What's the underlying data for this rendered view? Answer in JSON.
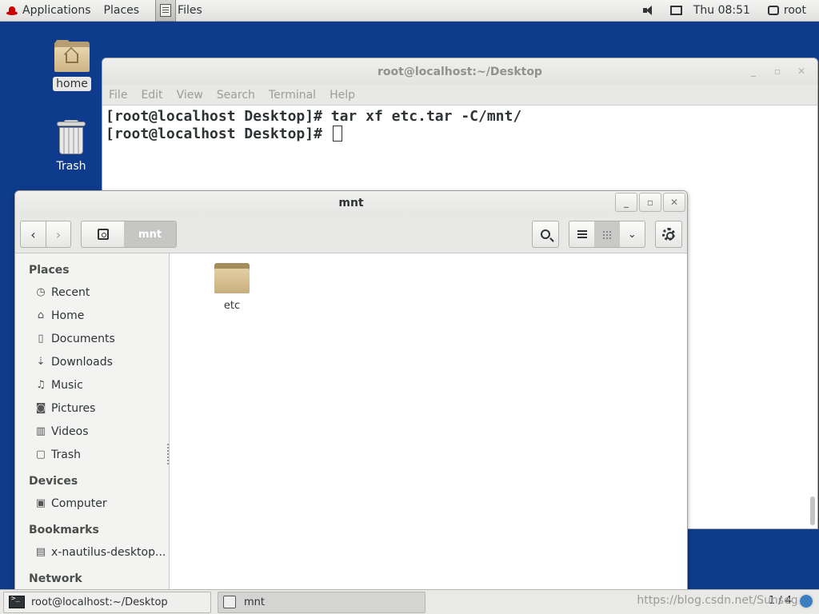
{
  "topbar": {
    "applications": "Applications",
    "places": "Places",
    "files": "Files",
    "clock": "Thu 08:51",
    "user": "root"
  },
  "desktop": {
    "home_label": "home",
    "trash_label": "Trash"
  },
  "terminal": {
    "title": "root@localhost:~/Desktop",
    "menu": [
      "File",
      "Edit",
      "View",
      "Search",
      "Terminal",
      "Help"
    ],
    "lines": [
      "[root@localhost Desktop]# tar xf etc.tar -C/mnt/",
      "[root@localhost Desktop]# "
    ]
  },
  "files": {
    "title": "mnt",
    "path_current": "mnt",
    "sidebar": {
      "places_header": "Places",
      "places": [
        "Recent",
        "Home",
        "Documents",
        "Downloads",
        "Music",
        "Pictures",
        "Videos",
        "Trash"
      ],
      "devices_header": "Devices",
      "devices": [
        "Computer"
      ],
      "bookmarks_header": "Bookmarks",
      "bookmarks": [
        "x-nautilus-desktop..."
      ],
      "network_header": "Network"
    },
    "items": [
      {
        "name": "etc"
      }
    ]
  },
  "taskbar": {
    "tasks": [
      "root@localhost:~/Desktop",
      "mnt"
    ],
    "workspace": "1 / 4",
    "watermark": "https://blog.csdn.net/Sunsegeli"
  }
}
